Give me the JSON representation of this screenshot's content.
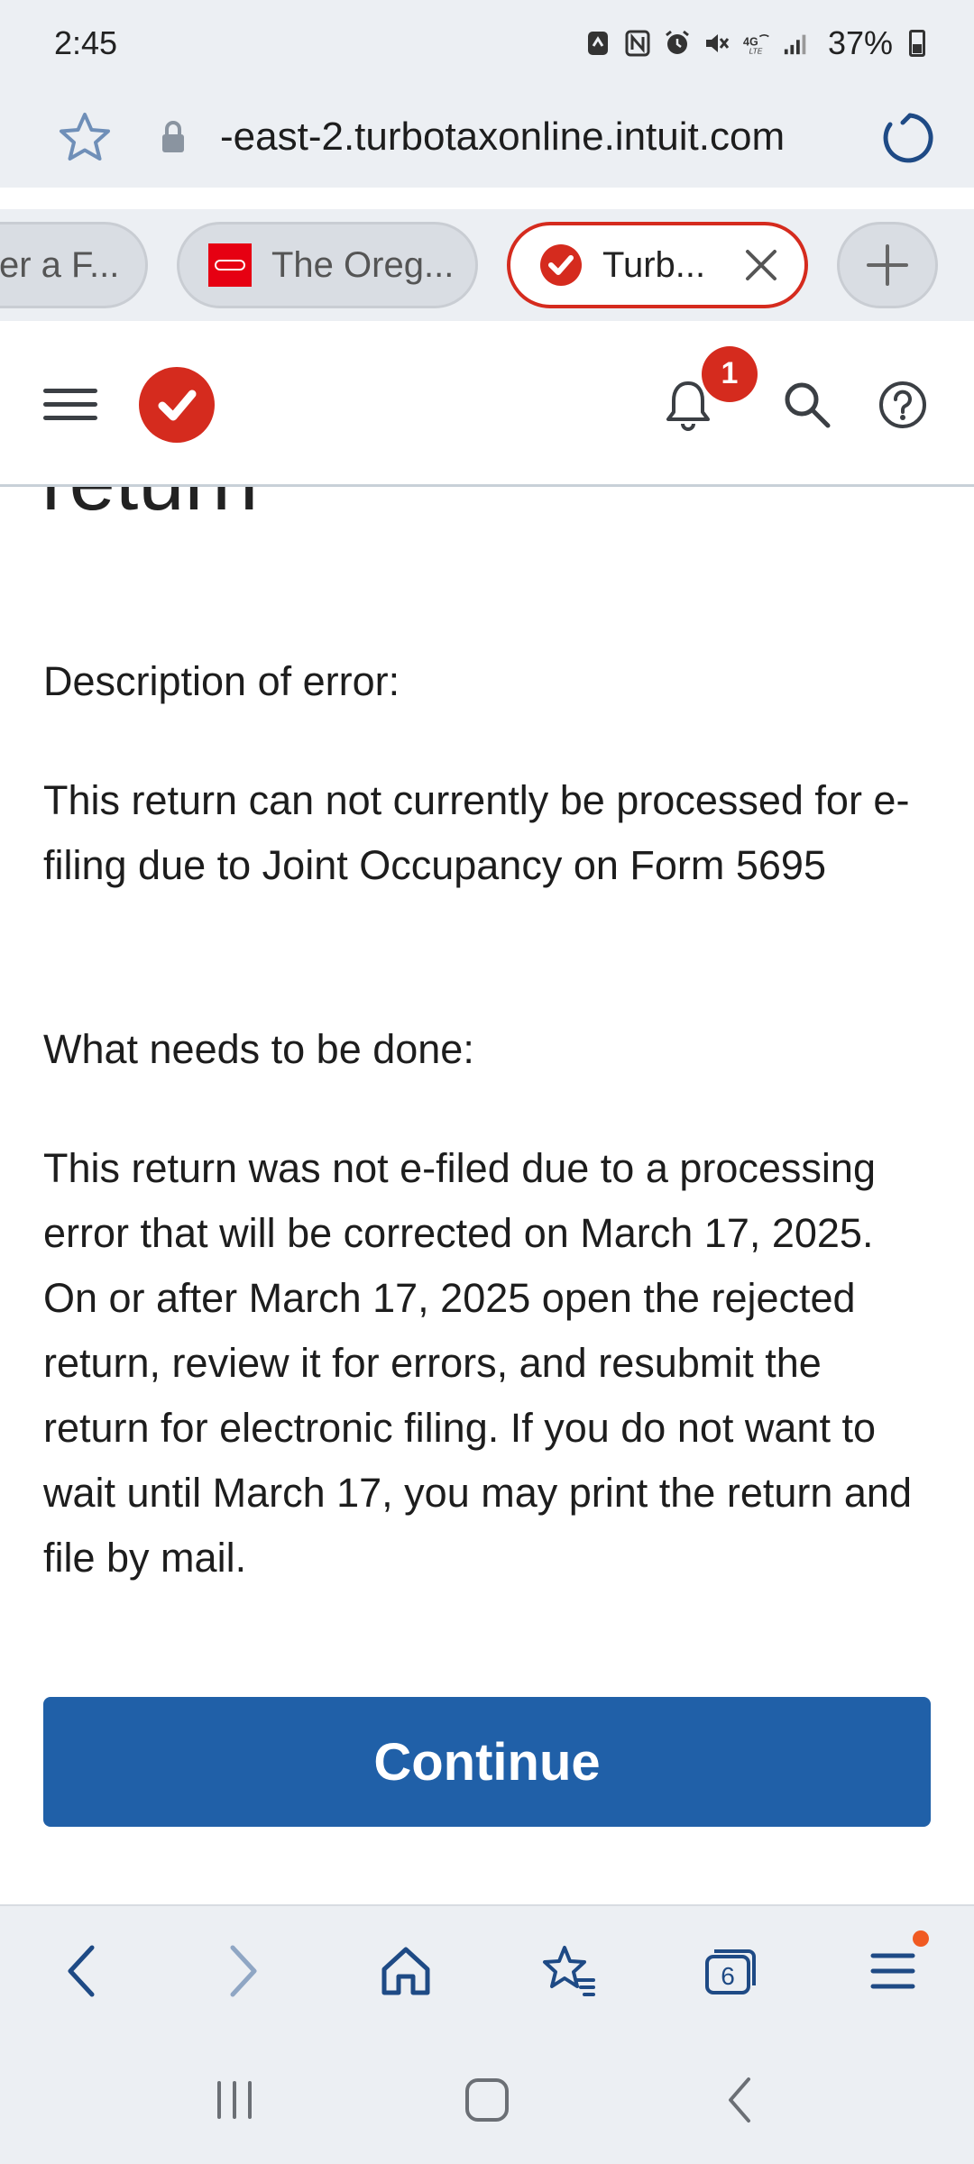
{
  "status_bar": {
    "time": "2:45",
    "battery": "37%"
  },
  "browser": {
    "url": "-east-2.turbotaxonline.intuit.com",
    "tabs": [
      {
        "label": "er a F..."
      },
      {
        "label": "The Oreg..."
      },
      {
        "label": "Turb..."
      }
    ],
    "tab_count": "6"
  },
  "header": {
    "notification_count": "1"
  },
  "content": {
    "cut_heading": "return",
    "description_label": "Description of error:",
    "description_text": "This return can not currently be processed for e-filing due to Joint Occupancy on Form 5695",
    "action_label": "What needs to be done:",
    "action_text": "This return was not e-filed due to a processing error that will be corrected on March 17, 2025. On or after March 17, 2025 open the rejected return, review it for errors, and resubmit the return for electronic filing. If you do not want to wait until March 17, you may print the return and file by mail.",
    "continue_label": "Continue"
  },
  "colors": {
    "brand_red": "#d52b1e",
    "primary_blue": "#2060a8",
    "chrome_bg": "#eceff3",
    "notification_dot": "#f05a22"
  }
}
